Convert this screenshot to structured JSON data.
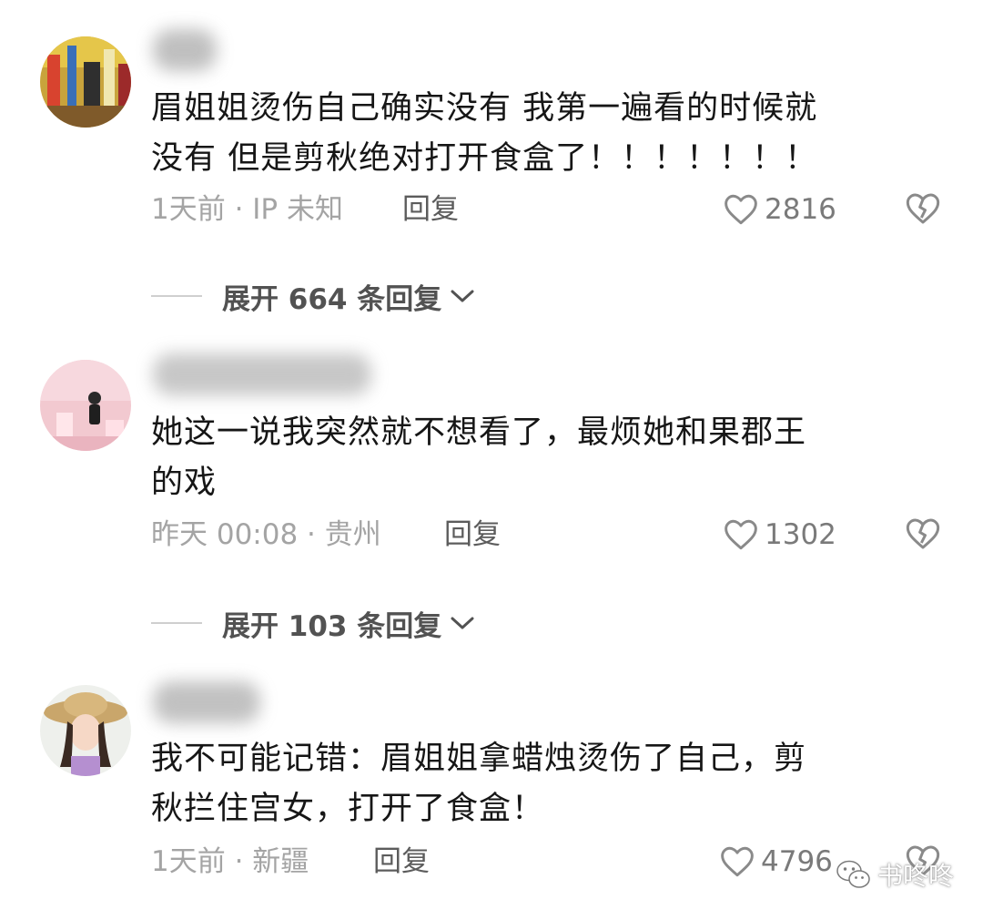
{
  "comments": [
    {
      "text": "眉姐姐烫伤自己确实没有 我第一遍看的时候就\n没有 但是剪秋绝对打开食盒了！！！！！！！",
      "time": "1天前 · IP 未知",
      "reply_label": "回复",
      "likes": "2816",
      "expand_label": "展开 664 条回复"
    },
    {
      "text": "她这一说我突然就不想看了，最烦她和果郡王\n的戏",
      "time": "昨天 00:08 · 贵州",
      "reply_label": "回复",
      "likes": "1302",
      "expand_label": "展开 103 条回复"
    },
    {
      "text": "我不可能记错：眉姐姐拿蜡烛烫伤了自己，剪\n秋拦住宫女，打开了食盒！",
      "time": "1天前 · 新疆",
      "reply_label": "回复",
      "likes": "4796"
    }
  ],
  "watermark": {
    "text": "书咚咚",
    "icon": "wechat-icon"
  },
  "icons": {
    "like": "heart-outline-icon",
    "dislike": "broken-heart-icon",
    "expand": "chevron-down-icon"
  },
  "colors": {
    "text": "#161616",
    "meta": "#a4a4a4",
    "reply": "#5c5c5c",
    "expand": "#525252"
  }
}
